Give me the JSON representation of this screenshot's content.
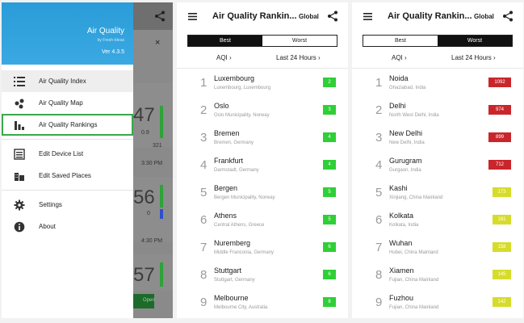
{
  "drawer": {
    "app_title": "Air Quality",
    "app_subtitle": "by Fresh-Ideas",
    "version": "Ver 4.3.5",
    "items": [
      {
        "label": "Air Quality Index",
        "icon": "list-icon"
      },
      {
        "label": "Air Quality Map",
        "icon": "map-icon"
      },
      {
        "label": "Air Quality Rankings",
        "icon": "bar-chart-icon"
      },
      {
        "label": "Edit Device List",
        "icon": "device-list-icon"
      },
      {
        "label": "Edit Saved Places",
        "icon": "buildings-icon"
      },
      {
        "label": "Settings",
        "icon": "gear-icon"
      },
      {
        "label": "About",
        "icon": "info-icon"
      }
    ]
  },
  "background": {
    "close": "×",
    "values": [
      "47",
      "0.9",
      "321",
      "3:30 PM",
      "56",
      "0",
      "4:30 PM",
      "57"
    ],
    "button": "Open"
  },
  "rankings_best": {
    "title": "Air Quality Rankin...",
    "scope": "Global",
    "toggle": {
      "best": "Best",
      "worst": "Worst",
      "selected": "Best"
    },
    "metric": "AQI",
    "period": "Last 24 Hours",
    "rows": [
      {
        "rank": "1",
        "city": "Luxembourg",
        "region": "Luxembourg, Luxembourg",
        "aqi": "2"
      },
      {
        "rank": "2",
        "city": "Oslo",
        "region": "Oslo Municipality, Norway",
        "aqi": "3"
      },
      {
        "rank": "3",
        "city": "Bremen",
        "region": "Bremen, Germany",
        "aqi": "4"
      },
      {
        "rank": "4",
        "city": "Frankfurt",
        "region": "Darmstadt, Germany",
        "aqi": "4"
      },
      {
        "rank": "5",
        "city": "Bergen",
        "region": "Bergen Municipality, Norway",
        "aqi": "5"
      },
      {
        "rank": "6",
        "city": "Athens",
        "region": "Central Athens, Greece",
        "aqi": "5"
      },
      {
        "rank": "7",
        "city": "Nuremberg",
        "region": "Middle Franconia, Germany",
        "aqi": "6"
      },
      {
        "rank": "8",
        "city": "Stuttgart",
        "region": "Stuttgart, Germany",
        "aqi": "6"
      },
      {
        "rank": "9",
        "city": "Melbourne",
        "region": "Melbourne City, Australia",
        "aqi": "8"
      }
    ]
  },
  "rankings_worst": {
    "title": "Air Quality Rankin...",
    "scope": "Global",
    "toggle": {
      "best": "Best",
      "worst": "Worst",
      "selected": "Worst"
    },
    "metric": "AQI",
    "period": "Last 24 Hours",
    "rows": [
      {
        "rank": "1",
        "city": "Noida",
        "region": "Ghaziabad, India",
        "aqi": "1092"
      },
      {
        "rank": "2",
        "city": "Delhi",
        "region": "North West Delhi, India",
        "aqi": "974"
      },
      {
        "rank": "3",
        "city": "New Delhi",
        "region": "New Delhi, India",
        "aqi": "899"
      },
      {
        "rank": "4",
        "city": "Gurugram",
        "region": "Gurgaon, India",
        "aqi": "712"
      },
      {
        "rank": "5",
        "city": "Kashi",
        "region": "Xinjiang, China Mainland",
        "aqi": "173"
      },
      {
        "rank": "6",
        "city": "Kolkata",
        "region": "Kolkata, India",
        "aqi": "161"
      },
      {
        "rank": "7",
        "city": "Wuhan",
        "region": "Hubei, China Mainland",
        "aqi": "158"
      },
      {
        "rank": "8",
        "city": "Xiamen",
        "region": "Fujian, China Mainland",
        "aqi": "145"
      },
      {
        "rank": "9",
        "city": "Fuzhou",
        "region": "Fujian, China Mainland",
        "aqi": "142"
      }
    ]
  },
  "colors": {
    "accent": "#3aa9e2",
    "good": "#2fcf37",
    "bad": "#c9262c",
    "moderate": "#d6dc2a",
    "selected_outline": "#3aa84a"
  }
}
